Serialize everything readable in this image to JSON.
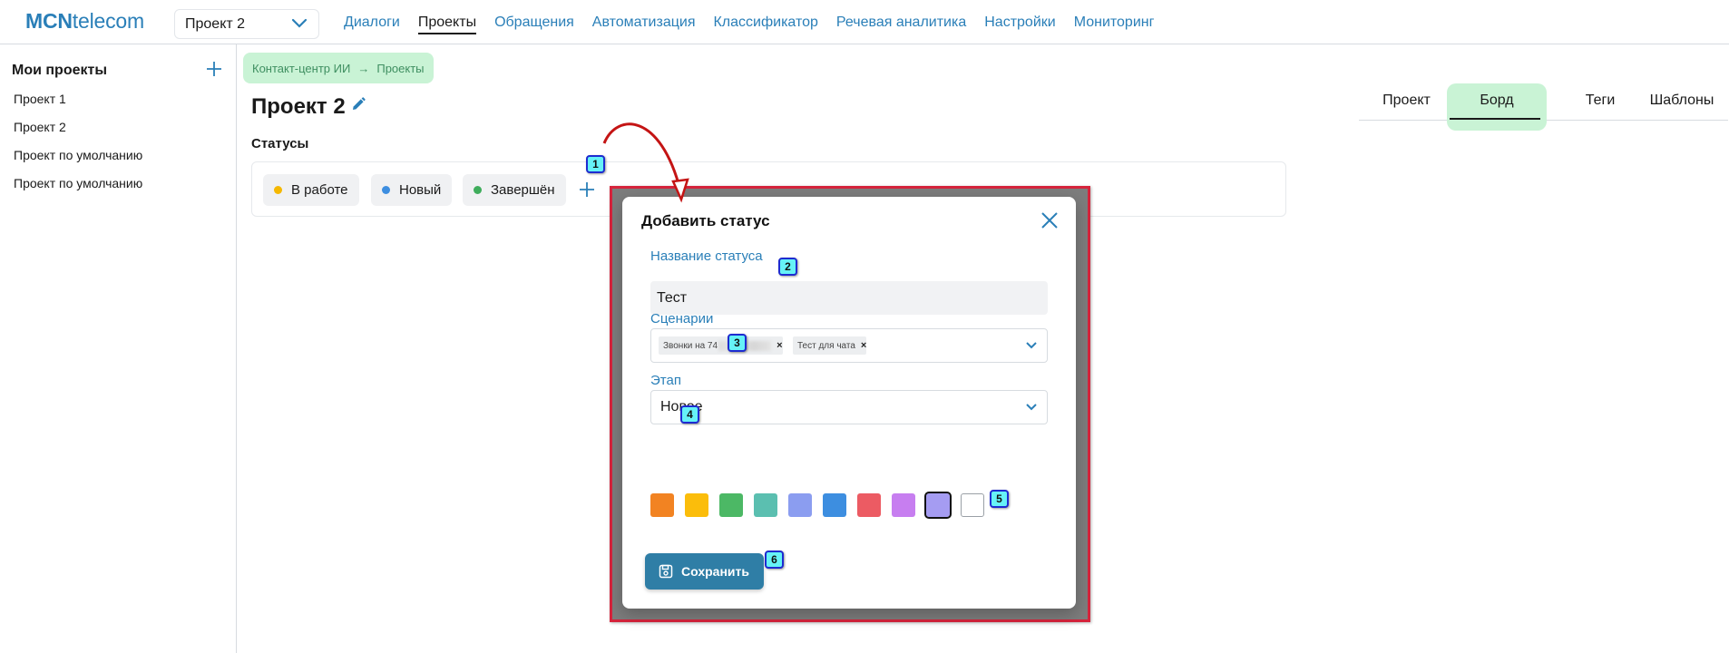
{
  "brand": {
    "bold": "MCN",
    "rest": "telecom"
  },
  "project_select": {
    "value": "Проект 2"
  },
  "topnav": [
    {
      "label": "Диалоги",
      "active": false
    },
    {
      "label": "Проекты",
      "active": true
    },
    {
      "label": "Обращения",
      "active": false
    },
    {
      "label": "Автоматизация",
      "active": false
    },
    {
      "label": "Классификатор",
      "active": false
    },
    {
      "label": "Речевая аналитика",
      "active": false
    },
    {
      "label": "Настройки",
      "active": false
    },
    {
      "label": "Мониторинг",
      "active": false
    }
  ],
  "sidebar": {
    "title": "Мои проекты",
    "items": [
      "Проект 1",
      "Проект 2",
      "Проект по умолчанию",
      "Проект по умолчанию"
    ]
  },
  "breadcrumb": {
    "part1": "Контакт-центр ИИ",
    "separator": "→",
    "part2": "Проекты"
  },
  "page_title": "Проект 2",
  "statuses": {
    "label": "Статусы",
    "items": [
      {
        "label": "В работе",
        "color": "#f5b800"
      },
      {
        "label": "Новый",
        "color": "#3d8ee0"
      },
      {
        "label": "Завершён",
        "color": "#3fad5c"
      }
    ]
  },
  "tabs": [
    {
      "label": "Проект",
      "active": false
    },
    {
      "label": "Борд",
      "active": true
    },
    {
      "label": "Теги",
      "active": false
    },
    {
      "label": "Шаблоны",
      "active": false
    }
  ],
  "modal": {
    "title": "Добавить статус",
    "name_label": "Название статуса",
    "name_value": "Тест",
    "scenarios_label": "Сценарии",
    "scenario_tags": [
      "Звонки на 74",
      "Тест для чата"
    ],
    "tag_remove": "×",
    "stage_label": "Этап",
    "stage_value": "Новое",
    "colors": [
      "#f28322",
      "#fbbd0b",
      "#4cb865",
      "#5bbfb0",
      "#8b9df0",
      "#3d8ee0",
      "#ec5b63",
      "#c77ef0",
      "#a59cf2",
      "#ffffff"
    ],
    "selected_color_index": 8,
    "save_label": "Сохранить"
  },
  "callouts": [
    "1",
    "2",
    "3",
    "4",
    "5",
    "6"
  ]
}
